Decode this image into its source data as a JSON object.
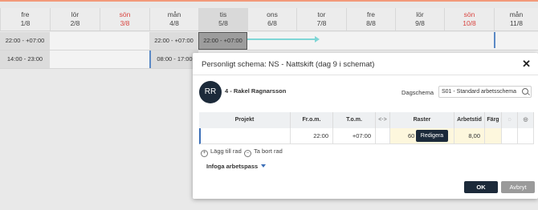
{
  "calendar": {
    "days": [
      {
        "name": "fre",
        "date": "1/8",
        "weekend": false
      },
      {
        "name": "lör",
        "date": "2/8",
        "weekend": false
      },
      {
        "name": "sön",
        "date": "3/8",
        "weekend": true
      },
      {
        "name": "mån",
        "date": "4/8",
        "weekend": false
      },
      {
        "name": "tis",
        "date": "5/8",
        "weekend": false
      },
      {
        "name": "ons",
        "date": "6/8",
        "weekend": false
      },
      {
        "name": "tor",
        "date": "7/8",
        "weekend": false
      },
      {
        "name": "fre",
        "date": "8/8",
        "weekend": false
      },
      {
        "name": "lör",
        "date": "9/8",
        "weekend": false
      },
      {
        "name": "sön",
        "date": "10/8",
        "weekend": true
      },
      {
        "name": "mån",
        "date": "11/8",
        "weekend": false
      }
    ],
    "row1": {
      "cell1": "22:00 - +07:00",
      "cell2": "22:00 - +07:00",
      "cell3": "22:00 - +07:00"
    },
    "row2": {
      "cell1": "14:00 - 23:00",
      "cell2": "08:00 - 17:00"
    }
  },
  "dialog": {
    "title": "Personligt schema: NS - Nattskift (dag 9 i schemat)",
    "close_icon": "close-icon",
    "avatar_initials": "RR",
    "person_name": "4 - Rakel Ragnarsson",
    "dagschema_label": "Dagschema",
    "dagschema_value": "S01 - Standard arbetsschema",
    "table": {
      "headers": {
        "projekt": "Projekt",
        "from": "Fr.o.m.",
        "tom": "T.o.m.",
        "swap_icon": "<·>",
        "raster": "Raster",
        "arbetstid": "Arbetstid",
        "farg": "Färg"
      },
      "row": {
        "projekt": "",
        "from": "22:00",
        "tom": "+07:00",
        "raster": "60",
        "arbetstid": "8,00",
        "farg": ""
      },
      "edit_label": "Redigera"
    },
    "add_row": "Lägg till rad",
    "remove_row": "Ta bort rad",
    "infoga": "Infoga arbetspass",
    "ok": "OK",
    "cancel": "Avbryt"
  },
  "colors": {
    "accent": "#1c2a3a",
    "weekend": "#d9443f",
    "highlight": "#7fd6d6",
    "link": "#3c6fb8"
  }
}
